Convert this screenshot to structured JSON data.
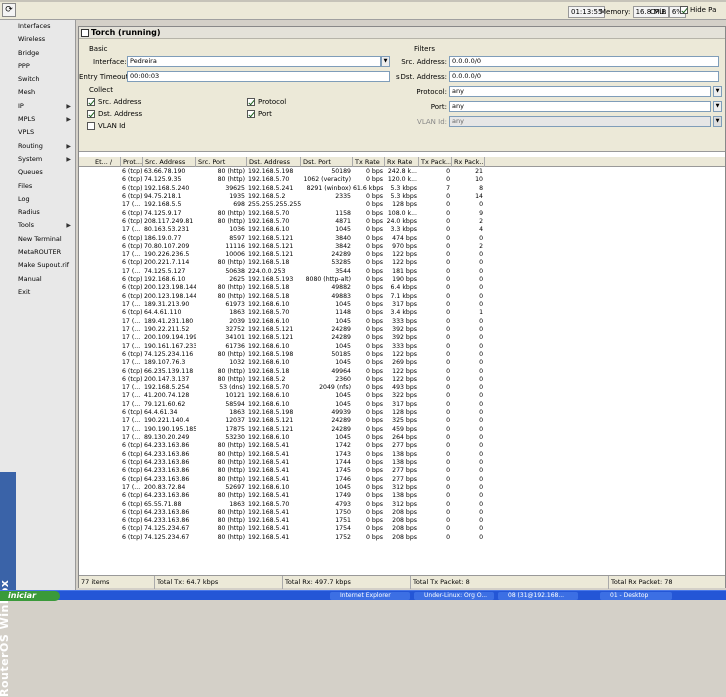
{
  "toolbar": {
    "refresh_label": "⟳"
  },
  "status": {
    "time": "01:13:55",
    "memory_label": "Memory:",
    "memory": "16.8 MiB",
    "cpu_label": "CPU:",
    "cpu": "6%",
    "hide_label": "Hide Pa"
  },
  "sidebar": {
    "items": [
      {
        "label": "Interfaces",
        "sub": false
      },
      {
        "label": "Wireless",
        "sub": false
      },
      {
        "label": "Bridge",
        "sub": false
      },
      {
        "label": "PPP",
        "sub": false
      },
      {
        "label": "Switch",
        "sub": false
      },
      {
        "label": "Mesh",
        "sub": false
      },
      {
        "label": "IP",
        "sub": true
      },
      {
        "label": "MPLS",
        "sub": true
      },
      {
        "label": "VPLS",
        "sub": false
      },
      {
        "label": "Routing",
        "sub": true
      },
      {
        "label": "System",
        "sub": true
      },
      {
        "label": "Queues",
        "sub": false
      },
      {
        "label": "Files",
        "sub": false
      },
      {
        "label": "Log",
        "sub": false
      },
      {
        "label": "Radius",
        "sub": false
      },
      {
        "label": "Tools",
        "sub": true
      },
      {
        "label": "New Terminal",
        "sub": false
      },
      {
        "label": "MetaROUTER",
        "sub": false
      },
      {
        "label": "Make Supout.rif",
        "sub": false
      },
      {
        "label": "Manual",
        "sub": false
      },
      {
        "label": "Exit",
        "sub": false
      }
    ],
    "brand": "RouterOS WinBox"
  },
  "window": {
    "title": "Torch (running)"
  },
  "basic": {
    "section": "Basic",
    "interface_label": "Interface:",
    "interface": "Pedreira",
    "timeout_label": "Entry Timeout:",
    "timeout": "00:00:03",
    "timeout_unit": "s"
  },
  "collect": {
    "section": "Collect",
    "src_address": "Src. Address",
    "dst_address": "Dst. Address",
    "vlan_id": "VLAN Id",
    "protocol": "Protocol",
    "port": "Port"
  },
  "filters": {
    "section": "Filters",
    "src_label": "Src. Address:",
    "src": "0.0.0.0/0",
    "dst_label": "Dst. Address:",
    "dst": "0.0.0.0/0",
    "protocol_label": "Protocol:",
    "protocol": "any",
    "port_label": "Port:",
    "port": "any",
    "vlan_label": "VLAN Id:",
    "vlan": "any"
  },
  "table": {
    "headers": [
      "Et... /",
      "Prot...",
      "Src. Address",
      "Src. Port",
      "Dst. Address",
      "Dst. Port",
      "Tx Rate",
      "Rx Rate",
      "Tx Pack...",
      "Rx Pack..."
    ],
    "rows": [
      [
        "6 (tcp)",
        "63.66.78.190",
        "80 (http)",
        "192.168.5.198",
        "50189",
        "0 bps",
        "242.8 k...",
        "0",
        "21"
      ],
      [
        "6 (tcp)",
        "74.125.9.35",
        "80 (http)",
        "192.168.5.70",
        "1062 (veracity)",
        "0 bps",
        "120.0 k...",
        "0",
        "10"
      ],
      [
        "6 (tcp)",
        "192.168.5.240",
        "39625",
        "192.168.5.241",
        "8291 (winbox)",
        "61.6 kbps",
        "5.3 kbps",
        "7",
        "8"
      ],
      [
        "6 (tcp)",
        "94.75.218.1",
        "1935",
        "192.168.5.2",
        "2335",
        "0 bps",
        "5.3 kbps",
        "0",
        "14"
      ],
      [
        "17 (...",
        "192.168.5.5",
        "698",
        "255.255.255.255",
        "",
        "0 bps",
        "128 bps",
        "0",
        "0"
      ],
      [
        "6 (tcp)",
        "74.125.9.17",
        "80 (http)",
        "192.168.5.70",
        "1158",
        "0 bps",
        "108.0 k...",
        "0",
        "9"
      ],
      [
        "6 (tcp)",
        "208.117.249.81",
        "80 (http)",
        "192.168.5.70",
        "4871",
        "0 bps",
        "24.0 kbps",
        "0",
        "2"
      ],
      [
        "17 (...",
        "80.163.53.231",
        "1036",
        "192.168.6.10",
        "1045",
        "0 bps",
        "3.3 kbps",
        "0",
        "4"
      ],
      [
        "6 (tcp)",
        "186.19.0.77",
        "8597",
        "192.168.5.121",
        "3840",
        "0 bps",
        "474 bps",
        "0",
        "0"
      ],
      [
        "6 (tcp)",
        "70.80.107.209",
        "11116",
        "192.168.5.121",
        "3842",
        "0 bps",
        "970 bps",
        "0",
        "2"
      ],
      [
        "17 (...",
        "190.226.236.5",
        "10006",
        "192.168.5.121",
        "24289",
        "0 bps",
        "122 bps",
        "0",
        "0"
      ],
      [
        "6 (tcp)",
        "200.221.7.114",
        "80 (http)",
        "192.168.5.18",
        "53285",
        "0 bps",
        "122 bps",
        "0",
        "0"
      ],
      [
        "17 (...",
        "74.125.5.127",
        "50638",
        "224.0.0.253",
        "3544",
        "0 bps",
        "181 bps",
        "0",
        "0"
      ],
      [
        "6 (tcp)",
        "192.168.6.10",
        "2625",
        "192.168.5.193",
        "8080 (http-alt)",
        "0 bps",
        "190 bps",
        "0",
        "0"
      ],
      [
        "6 (tcp)",
        "200.123.198.144",
        "80 (http)",
        "192.168.5.18",
        "49882",
        "0 bps",
        "6.4 kbps",
        "0",
        "0"
      ],
      [
        "6 (tcp)",
        "200.123.198.144",
        "80 (http)",
        "192.168.5.18",
        "49883",
        "0 bps",
        "7.1 kbps",
        "0",
        "0"
      ],
      [
        "17 (...",
        "189.31.213.90",
        "61973",
        "192.168.6.10",
        "1045",
        "0 bps",
        "317 bps",
        "0",
        "0"
      ],
      [
        "6 (tcp)",
        "64.4.61.110",
        "1863",
        "192.168.5.70",
        "1148",
        "0 bps",
        "3.4 kbps",
        "0",
        "1"
      ],
      [
        "17 (...",
        "189.41.231.180",
        "2039",
        "192.168.6.10",
        "1045",
        "0 bps",
        "333 bps",
        "0",
        "0"
      ],
      [
        "17 (...",
        "190.22.211.52",
        "32752",
        "192.168.5.121",
        "24289",
        "0 bps",
        "392 bps",
        "0",
        "0"
      ],
      [
        "17 (...",
        "200.109.194.199",
        "34101",
        "192.168.5.121",
        "24289",
        "0 bps",
        "392 bps",
        "0",
        "0"
      ],
      [
        "17 (...",
        "190.161.167.233",
        "61736",
        "192.168.6.10",
        "1045",
        "0 bps",
        "333 bps",
        "0",
        "0"
      ],
      [
        "6 (tcp)",
        "74.125.234.116",
        "80 (http)",
        "192.168.5.198",
        "50185",
        "0 bps",
        "122 bps",
        "0",
        "0"
      ],
      [
        "17 (...",
        "189.107.76.3",
        "1032",
        "192.168.6.10",
        "1045",
        "0 bps",
        "269 bps",
        "0",
        "0"
      ],
      [
        "6 (tcp)",
        "66.235.139.118",
        "80 (http)",
        "192.168.5.18",
        "49964",
        "0 bps",
        "122 bps",
        "0",
        "0"
      ],
      [
        "6 (tcp)",
        "200.147.3.137",
        "80 (http)",
        "192.168.5.2",
        "2360",
        "0 bps",
        "122 bps",
        "0",
        "0"
      ],
      [
        "17 (...",
        "192.168.5.254",
        "53 (dns)",
        "192.168.5.70",
        "2049 (nfs)",
        "0 bps",
        "493 bps",
        "0",
        "0"
      ],
      [
        "17 (...",
        "41.200.74.128",
        "10121",
        "192.168.6.10",
        "1045",
        "0 bps",
        "322 bps",
        "0",
        "0"
      ],
      [
        "17 (...",
        "79.121.60.62",
        "58594",
        "192.168.6.10",
        "1045",
        "0 bps",
        "317 bps",
        "0",
        "0"
      ],
      [
        "6 (tcp)",
        "64.4.61.34",
        "1863",
        "192.168.5.198",
        "49939",
        "0 bps",
        "128 bps",
        "0",
        "0"
      ],
      [
        "17 (...",
        "190.221.140.4",
        "12037",
        "192.168.5.121",
        "24289",
        "0 bps",
        "325 bps",
        "0",
        "0"
      ],
      [
        "17 (...",
        "190.190.195.185",
        "17875",
        "192.168.5.121",
        "24289",
        "0 bps",
        "459 bps",
        "0",
        "0"
      ],
      [
        "17 (...",
        "89.130.20.249",
        "53230",
        "192.168.6.10",
        "1045",
        "0 bps",
        "264 bps",
        "0",
        "0"
      ],
      [
        "6 (tcp)",
        "64.233.163.86",
        "80 (http)",
        "192.168.5.41",
        "1742",
        "0 bps",
        "277 bps",
        "0",
        "0"
      ],
      [
        "6 (tcp)",
        "64.233.163.86",
        "80 (http)",
        "192.168.5.41",
        "1743",
        "0 bps",
        "138 bps",
        "0",
        "0"
      ],
      [
        "6 (tcp)",
        "64.233.163.86",
        "80 (http)",
        "192.168.5.41",
        "1744",
        "0 bps",
        "138 bps",
        "0",
        "0"
      ],
      [
        "6 (tcp)",
        "64.233.163.86",
        "80 (http)",
        "192.168.5.41",
        "1745",
        "0 bps",
        "277 bps",
        "0",
        "0"
      ],
      [
        "6 (tcp)",
        "64.233.163.86",
        "80 (http)",
        "192.168.5.41",
        "1746",
        "0 bps",
        "277 bps",
        "0",
        "0"
      ],
      [
        "17 (...",
        "200.83.72.84",
        "52697",
        "192.168.6.10",
        "1045",
        "0 bps",
        "312 bps",
        "0",
        "0"
      ],
      [
        "6 (tcp)",
        "64.233.163.86",
        "80 (http)",
        "192.168.5.41",
        "1749",
        "0 bps",
        "138 bps",
        "0",
        "0"
      ],
      [
        "6 (tcp)",
        "65.55.71.88",
        "1863",
        "192.168.5.70",
        "4793",
        "0 bps",
        "312 bps",
        "0",
        "0"
      ],
      [
        "6 (tcp)",
        "64.233.163.86",
        "80 (http)",
        "192.168.5.41",
        "1750",
        "0 bps",
        "208 bps",
        "0",
        "0"
      ],
      [
        "6 (tcp)",
        "64.233.163.86",
        "80 (http)",
        "192.168.5.41",
        "1751",
        "0 bps",
        "208 bps",
        "0",
        "0"
      ],
      [
        "6 (tcp)",
        "74.125.234.67",
        "80 (http)",
        "192.168.5.41",
        "1754",
        "0 bps",
        "208 bps",
        "0",
        "0"
      ],
      [
        "6 (tcp)",
        "74.125.234.67",
        "80 (http)",
        "192.168.5.41",
        "1752",
        "0 bps",
        "208 bps",
        "0",
        "0"
      ]
    ]
  },
  "footer": {
    "items": "77 items",
    "total_tx": "Total Tx: 64.7 kbps",
    "total_rx": "Total Rx: 497.7 kbps",
    "total_tx_packet": "Total Tx Packet: 8",
    "total_rx_packet": "Total Rx Packet: 78"
  },
  "taskbar": {
    "start": "iniciar",
    "tasks": [
      "Internet Explorer",
      "Under-Linux: Org O...",
      "08 (31@192.168...",
      "01 - Desktop"
    ]
  }
}
